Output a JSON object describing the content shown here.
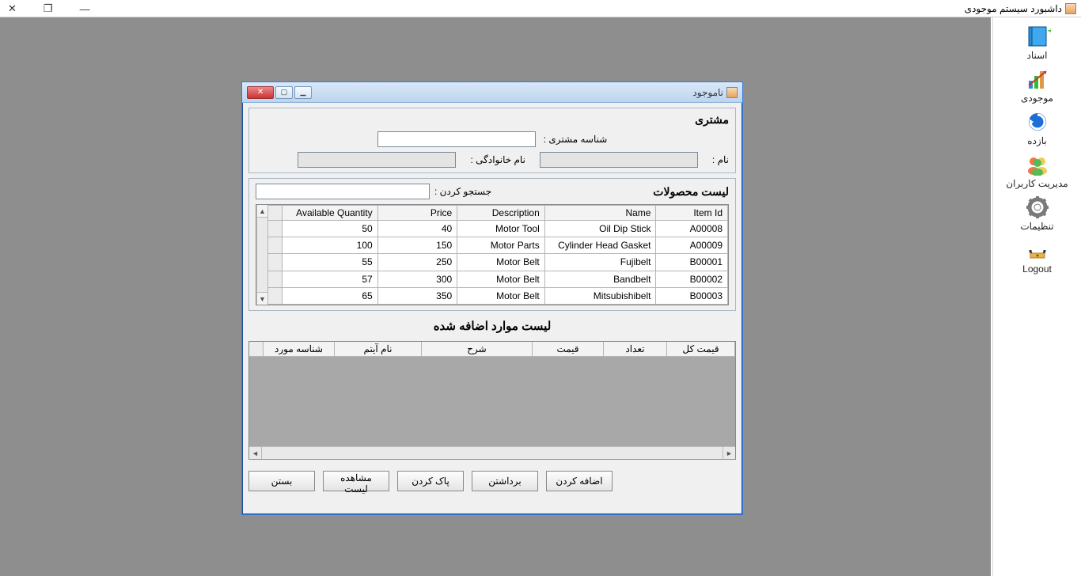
{
  "main_window": {
    "title": "داشبورد سیستم موجودی",
    "sys": {
      "minimize": "—",
      "restore": "❐",
      "close": "✕"
    }
  },
  "toolstrip": [
    {
      "key": "docs",
      "label": "اسناد"
    },
    {
      "key": "inventory",
      "label": "موجودی"
    },
    {
      "key": "returns",
      "label": "بازده"
    },
    {
      "key": "users",
      "label": "مدیریت کاربران"
    },
    {
      "key": "settings",
      "label": "تنظیمات"
    },
    {
      "key": "logout",
      "label": "Logout"
    }
  ],
  "dialog": {
    "title": "ناموجود",
    "sys": {
      "minimize": "▁",
      "maximize": "▢",
      "close": "✕"
    },
    "customer": {
      "heading": "مشتری",
      "id_label": "شناسه مشتری :",
      "name_label": "نام :",
      "family_label": "نام خانوادگی :"
    },
    "products": {
      "heading": "لیست محصولات",
      "search_label": "جستجو کردن :",
      "columns": [
        "Available Quantity",
        "Price",
        "Description",
        "Name",
        "Item Id"
      ],
      "rows": [
        {
          "qty": "50",
          "price": "40",
          "desc": "Motor Tool",
          "name": "Oil Dip Stick",
          "id": "A00008"
        },
        {
          "qty": "100",
          "price": "150",
          "desc": "Motor Parts",
          "name": "Cylinder Head Gasket",
          "id": "A00009"
        },
        {
          "qty": "55",
          "price": "250",
          "desc": "Motor Belt",
          "name": "Fujibelt",
          "id": "B00001"
        },
        {
          "qty": "57",
          "price": "300",
          "desc": "Motor Belt",
          "name": "Bandbelt",
          "id": "B00002"
        },
        {
          "qty": "65",
          "price": "350",
          "desc": "Motor Belt",
          "name": "Mitsubishibelt",
          "id": "B00003"
        }
      ]
    },
    "added": {
      "heading": "لیست موارد اضافه شده",
      "columns": [
        "شناسه مورد",
        "نام آیتم",
        "شرح",
        "قیمت",
        "تعداد",
        "قیمت کل"
      ]
    },
    "buttons": {
      "add": "اضافه کردن",
      "remove": "برداشتن",
      "clear": "پاک کردن",
      "view": "مشاهده لیست",
      "close": "بستن"
    }
  }
}
